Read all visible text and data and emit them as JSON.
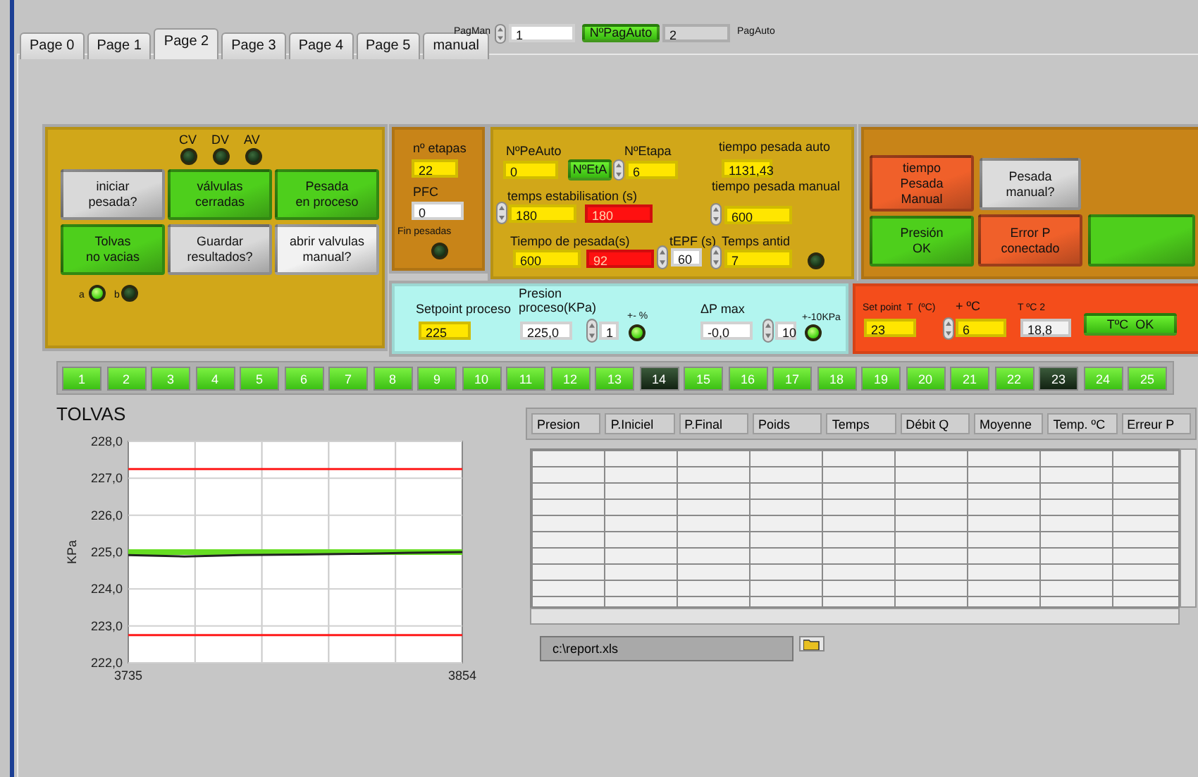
{
  "tabs": [
    {
      "label": "Page 0",
      "selected": false
    },
    {
      "label": "Page 1",
      "selected": false
    },
    {
      "label": "Page 2",
      "selected": true
    },
    {
      "label": "Page 3",
      "selected": false
    },
    {
      "label": "Page 4",
      "selected": false
    },
    {
      "label": "Page 5",
      "selected": false
    },
    {
      "label": "manual",
      "selected": false
    }
  ],
  "page_selector": {
    "pagman_label": "PagMan",
    "pagman_value": "1",
    "auto_button": {
      "label": "NºPagAuto",
      "on": true
    },
    "pagauto_value": "2",
    "pagauto_label": "PagAuto"
  },
  "control_panel": {
    "indicators": [
      {
        "label": "CV",
        "on": false
      },
      {
        "label": "DV",
        "on": false
      },
      {
        "label": "AV",
        "on": false
      }
    ],
    "buttons": [
      {
        "label": "iniciar\npesada?",
        "color": "#d9d9d9"
      },
      {
        "label": "válvulas\ncerradas",
        "color": "#4ecf1c"
      },
      {
        "label": "Pesada\nen proceso",
        "color": "#4ecf1c"
      },
      {
        "label": "Tolvas\nno vacias",
        "color": "#4ecf1c"
      },
      {
        "label": "Guardar\nresultados?",
        "color": "#d9d9d9"
      },
      {
        "label": "abrir valvulas\nmanual?",
        "color": "#f2f2f2"
      }
    ],
    "leds": [
      {
        "label": "a",
        "on": true
      },
      {
        "label": "b",
        "on": false
      }
    ]
  },
  "etapas_panel": {
    "etapas_label": "nº etapas",
    "etapas": {
      "value": "22",
      "color": "#ffe600"
    },
    "pfc_label": "PFC",
    "pfc": {
      "value": "0",
      "color": "#ffffff"
    },
    "fin_label": "Fin pesadas",
    "fin_on": false
  },
  "timing_panel": {
    "pe_auto_label": "NºPeAuto",
    "pe_auto": {
      "value": "0",
      "color": "#ffe600"
    },
    "eta_button": {
      "label": "NºEtA",
      "on": true
    },
    "etapa_label": "NºEtapa",
    "etapa": {
      "value": "6",
      "color": "#ffe600"
    },
    "auto_label": "tiempo pesada auto",
    "auto": {
      "value": "1131,43",
      "color": "#ffe600"
    },
    "manual_label": "tiempo pesada manual",
    "manual": {
      "value": "600",
      "color": "#ffe600"
    },
    "estab_label": "temps estabilisation (s)",
    "estab": [
      {
        "value": "180",
        "color": "#ffe600"
      },
      {
        "value": "180",
        "color": "#ff1010"
      }
    ],
    "pesada_label": "Tiempo de pesada(s)",
    "pesada": [
      {
        "value": "600",
        "color": "#ffe600"
      },
      {
        "value": "92",
        "color": "#ff1010"
      }
    ],
    "tepf_label": "tEPF (s)",
    "tepf": {
      "value": "60",
      "color": "#ffffff"
    },
    "antid_label": "Temps antid",
    "antid": {
      "value": "7",
      "color": "#ffe600"
    },
    "antid_on": false
  },
  "manual_panel": {
    "buttons": [
      {
        "label": "tiempo\nPesada\nManual",
        "color": "#f0602a"
      },
      {
        "label": "Pesada\nmanual?",
        "color": "#dcdcdc"
      },
      {
        "label": "Presión\nOK",
        "color": "#4ecf1c"
      },
      {
        "label": "Error P\nconectado",
        "color": "#f0602a"
      },
      {
        "color": "#4ecf1c"
      }
    ]
  },
  "setpoint_panel": {
    "setpoint_label": "Setpoint proceso",
    "setpoint": {
      "value": "225",
      "color": "#ffe600"
    },
    "presion_label": "Presion\nproceso(KPa)",
    "presion": {
      "value": "225,0",
      "color": "#ffffff"
    },
    "tol": {
      "value": "1",
      "color": "#ffffff"
    },
    "pct_label": "+- %",
    "pct_on": true,
    "dp_label": "ΔP max",
    "dp": {
      "value": "-0,0",
      "color": "#ffffff"
    },
    "dp_tol": {
      "value": "10",
      "color": "#ffffff"
    },
    "kpa_label": "+-10KPa",
    "kpa_on": true
  },
  "temp_panel": {
    "sp_label": "Set point  T  (ºC)",
    "sp": {
      "value": "23",
      "color": "#ffe600"
    },
    "plus_label": "+ ºC",
    "plus": {
      "value": "6",
      "color": "#ffe600"
    },
    "t2_label": "T ºC 2",
    "t2": {
      "value": "18,8",
      "color": "#f2f2f2"
    },
    "ok_button": {
      "label": "TºC  OK",
      "on": true
    }
  },
  "steps": [
    {
      "label": "1",
      "on": true
    },
    {
      "label": "2",
      "on": true
    },
    {
      "label": "3",
      "on": true
    },
    {
      "label": "4",
      "on": true
    },
    {
      "label": "5",
      "on": true
    },
    {
      "label": "6",
      "on": true
    },
    {
      "label": "7",
      "on": true
    },
    {
      "label": "8",
      "on": true
    },
    {
      "label": "9",
      "on": true
    },
    {
      "label": "10",
      "on": true
    },
    {
      "label": "11",
      "on": true
    },
    {
      "label": "12",
      "on": true
    },
    {
      "label": "13",
      "on": true
    },
    {
      "label": "14",
      "on": false
    },
    {
      "label": "15",
      "on": true
    },
    {
      "label": "16",
      "on": true
    },
    {
      "label": "17",
      "on": true
    },
    {
      "label": "18",
      "on": true
    },
    {
      "label": "19",
      "on": true
    },
    {
      "label": "20",
      "on": true
    },
    {
      "label": "21",
      "on": true
    },
    {
      "label": "22",
      "on": true
    },
    {
      "label": "23",
      "on": false
    },
    {
      "label": "24",
      "on": true
    },
    {
      "label": "25",
      "on": true
    }
  ],
  "graph": {
    "title": "TOLVAS",
    "chart_data": {
      "type": "line",
      "ylabel": "KPa",
      "x": [
        3735,
        3755,
        3775,
        3795,
        3815,
        3835,
        3854
      ],
      "series": [
        {
          "color": "#ff1a1a",
          "values": [
            227.25,
            227.25,
            227.25,
            227.25,
            227.25,
            227.25,
            227.25
          ]
        },
        {
          "color": "#ff1a1a",
          "values": [
            222.75,
            222.75,
            222.75,
            222.75,
            222.75,
            222.75,
            222.75
          ]
        },
        {
          "color": "#66dd22",
          "values": [
            225.0,
            225.0,
            225.0,
            225.0,
            225.0,
            225.0,
            225.0
          ]
        },
        {
          "color": "#222222",
          "values": [
            224.92,
            224.88,
            224.92,
            224.93,
            224.95,
            224.98,
            225.0
          ]
        }
      ],
      "grid": true,
      "xlim": [
        3735,
        3854
      ],
      "ylim": [
        222,
        228
      ],
      "xticks": [
        3735,
        3854
      ],
      "yticks": [
        {
          "value": 222,
          "label": "222,0"
        },
        {
          "value": 223,
          "label": "223,0"
        },
        {
          "value": 224,
          "label": "224,0"
        },
        {
          "value": 225,
          "label": "225,0"
        },
        {
          "value": 226,
          "label": "226,0"
        },
        {
          "value": 227,
          "label": "227,0"
        },
        {
          "value": 228,
          "label": "228,0"
        }
      ]
    }
  },
  "table": {
    "columns": [
      "Presion",
      "P.Iniciel",
      "P.Final",
      "Poids",
      "Temps",
      "Débit Q",
      "Moyenne",
      "Temp. ºC",
      "Erreur P"
    ]
  },
  "file_path": {
    "value": "c:\\report.xls"
  }
}
